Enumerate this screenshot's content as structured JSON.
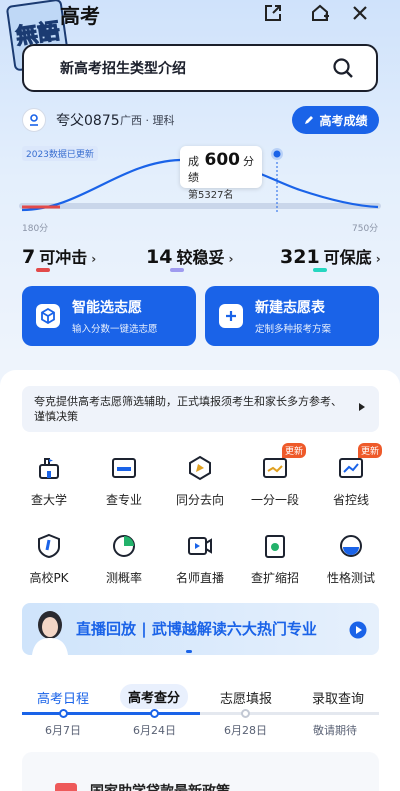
{
  "app": {
    "title": "高考",
    "logo_text": "無語"
  },
  "search": {
    "text": "新高考招生类型介绍"
  },
  "user": {
    "name": "夸父0875",
    "region": "广西 · 理科",
    "score_button": "高考成绩"
  },
  "chart": {
    "badge": "2023数据已更新",
    "tooltip_label": "成绩",
    "tooltip_score": "600",
    "tooltip_unit": "分",
    "tooltip_rank": "第5327名",
    "axis_min": "180分",
    "axis_max": "750分"
  },
  "chart_data": {
    "type": "line",
    "x_range": [
      180,
      750
    ],
    "marker_x": 600,
    "xlabel": "",
    "ylabel": ""
  },
  "stats": [
    {
      "num": "7",
      "label": "可冲击",
      "color": "#e24a4a"
    },
    {
      "num": "14",
      "label": "较稳妥",
      "color": "#9f9bef"
    },
    {
      "num": "321",
      "label": "可保底",
      "color": "#25d6c0"
    }
  ],
  "cards": [
    {
      "title": "智能选志愿",
      "sub": "输入分数一键选志愿"
    },
    {
      "title": "新建志愿表",
      "sub": "定制多种报考方案"
    }
  ],
  "notice": "夸克提供高考志愿筛选辅助，正式填报须考生和家长多方参考、谨慎决策",
  "grid": [
    {
      "label": "查大学",
      "icon": "university-icon"
    },
    {
      "label": "查专业",
      "icon": "major-icon"
    },
    {
      "label": "同分去向",
      "icon": "compass-icon"
    },
    {
      "label": "一分一段",
      "icon": "score-segment-icon",
      "badge": "更新"
    },
    {
      "label": "省控线",
      "icon": "control-line-icon",
      "badge": "更新"
    },
    {
      "label": "高校PK",
      "icon": "pk-icon"
    },
    {
      "label": "测概率",
      "icon": "probability-icon"
    },
    {
      "label": "名师直播",
      "icon": "live-icon"
    },
    {
      "label": "查扩缩招",
      "icon": "enroll-change-icon"
    },
    {
      "label": "性格测试",
      "icon": "personality-icon"
    }
  ],
  "banner": {
    "text": "直播回放 | 武博越解读六大热门专业"
  },
  "tabs": [
    {
      "label": "高考日程",
      "date": "6月7日"
    },
    {
      "label": "高考查分",
      "date": "6月24日"
    },
    {
      "label": "志愿填报",
      "date": "6月28日"
    },
    {
      "label": "录取查询",
      "date": "敬请期待"
    }
  ],
  "bottom": {
    "text": "国家助学贷款最新政策..."
  },
  "colors": {
    "accent": "#1a63e8",
    "badge": "#ee5a2a"
  }
}
